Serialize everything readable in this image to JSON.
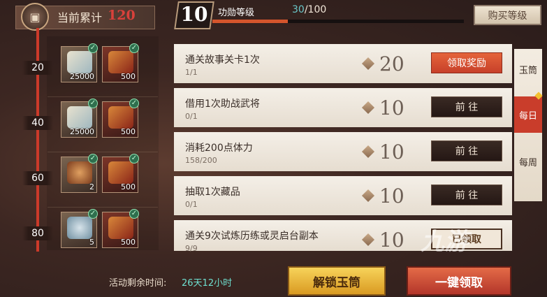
{
  "header": {
    "title_label": "当前累计",
    "title_value": "120",
    "icon": "crate-icon"
  },
  "level": {
    "number": "10",
    "label": "功勋等级",
    "progress_current": "30",
    "progress_total": "/100",
    "progress_fraction": 0.3,
    "buy_button": "购买等级"
  },
  "milestones": [
    {
      "tick": "20",
      "rewards": [
        {
          "icon": "scroll-icon",
          "qty": "25000",
          "claimed": true
        },
        {
          "icon": "red-book-icon",
          "qty": "500",
          "claimed": true
        }
      ]
    },
    {
      "tick": "40",
      "rewards": [
        {
          "icon": "scroll-icon",
          "qty": "25000",
          "claimed": true
        },
        {
          "icon": "red-book-icon",
          "qty": "500",
          "claimed": true
        }
      ]
    },
    {
      "tick": "60",
      "rewards": [
        {
          "icon": "food-plate-icon",
          "qty": "2",
          "claimed": true
        },
        {
          "icon": "red-book-icon",
          "qty": "500",
          "claimed": true
        }
      ]
    },
    {
      "tick": "80",
      "rewards": [
        {
          "icon": "pouch-icon",
          "qty": "5",
          "claimed": true
        },
        {
          "icon": "red-book-icon",
          "qty": "500",
          "claimed": true
        }
      ]
    }
  ],
  "tasks": [
    {
      "title": "通关故事关卡1次",
      "progress": "1/1",
      "points": "20",
      "button": "领取奖励",
      "state": "claim"
    },
    {
      "title": "借用1次助战武将",
      "progress": "0/1",
      "points": "10",
      "button": "前 往",
      "state": "goto"
    },
    {
      "title": "消耗200点体力",
      "progress": "158/200",
      "points": "10",
      "button": "前 往",
      "state": "goto"
    },
    {
      "title": "抽取1次藏品",
      "progress": "0/1",
      "points": "10",
      "button": "前 往",
      "state": "goto"
    },
    {
      "title": "通关9次试炼历练或灵启台副本",
      "progress": "9/9",
      "points": "10",
      "button": "已领取",
      "state": "done"
    }
  ],
  "tabs": [
    {
      "label": "玉筒",
      "active": false
    },
    {
      "label": "每日",
      "active": true
    },
    {
      "label": "每周",
      "active": false
    }
  ],
  "footer": {
    "remaining_label": "活动剩余时间:",
    "remaining_value": "26天12小时",
    "unlock_button": "解锁玉筒",
    "claim_all_button": "一键领取"
  },
  "watermark": "九游",
  "colors": {
    "accent_red": "#c93d2b",
    "progress_cyan": "#69c6c8",
    "gold": "#f7d35a"
  }
}
